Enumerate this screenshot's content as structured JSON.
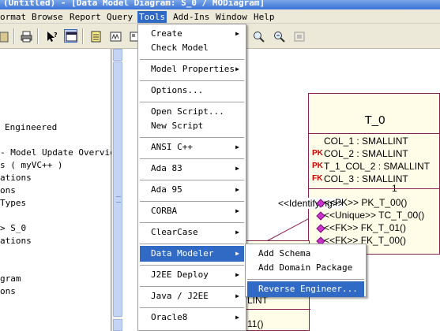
{
  "window": {
    "title": "(Untitled) - [Data Model Diagram: S_0 / MODiagram]"
  },
  "menubar": [
    {
      "id": "format",
      "label": "ormat"
    },
    {
      "id": "browse",
      "label": "Browse"
    },
    {
      "id": "report",
      "label": "Report"
    },
    {
      "id": "query",
      "label": "Query"
    },
    {
      "id": "tools",
      "label": "Tools"
    },
    {
      "id": "addins",
      "label": "Add-Ins"
    },
    {
      "id": "window",
      "label": "Window"
    },
    {
      "id": "help",
      "label": "Help"
    }
  ],
  "tree": [
    "Engineered",
    "- Model Update Overview",
    "s ( myVC++ )",
    "ations",
    "ons",
    "Types",
    "> S_0",
    "ations",
    "gram",
    "ons"
  ],
  "tools_menu": [
    {
      "label": "Create",
      "submenu": true
    },
    {
      "label": "Check Model",
      "submenu": false
    },
    {
      "label": "Model Properties",
      "submenu": true
    },
    {
      "label": "Options...",
      "submenu": false
    },
    {
      "label": "Open Script...",
      "submenu": false
    },
    {
      "label": "New Script",
      "submenu": false
    },
    {
      "label": "ANSI C++",
      "submenu": true
    },
    {
      "label": "Ada 83",
      "submenu": true
    },
    {
      "label": "Ada 95",
      "submenu": true
    },
    {
      "label": "CORBA",
      "submenu": true
    },
    {
      "label": "ClearCase",
      "submenu": true
    },
    {
      "label": "Data Modeler",
      "submenu": true,
      "highlighted": true
    },
    {
      "label": "J2EE Deploy",
      "submenu": true
    },
    {
      "label": "Java / J2EE",
      "submenu": true
    },
    {
      "label": "Oracle8",
      "submenu": true
    }
  ],
  "data_modeler_submenu": [
    {
      "label": "Add Schema"
    },
    {
      "label": "Add Domain Package"
    },
    {
      "label": "Reverse Engineer...",
      "highlighted": true
    }
  ],
  "diagram": {
    "table_t0": {
      "name": "T_0",
      "columns": [
        {
          "key": "",
          "text": "COL_1 : SMALLINT"
        },
        {
          "key": "PK",
          "text": "COL_2 : SMALLINT"
        },
        {
          "key": "PK",
          "text": "T_1_COL_2 : SMALLINT"
        },
        {
          "key": "FK",
          "text": "COL_3 : SMALLINT"
        }
      ],
      "multiplicity": "1",
      "operations": [
        "<<PK>> PK_T_00()",
        "<<Unique>> TC_T_00()",
        "<<FK>> FK_T_01()",
        "<<FK>> FK_T_00()"
      ]
    },
    "relationship_label": "<<Identifying>>",
    "table_s0_partial": {
      "row1": "LINT",
      "row2": "11()"
    }
  },
  "colors": {
    "selection": "#316ac5",
    "entity_border": "#8b2252",
    "entity_fill": "#fffde8",
    "key_red": "#cc0000"
  }
}
